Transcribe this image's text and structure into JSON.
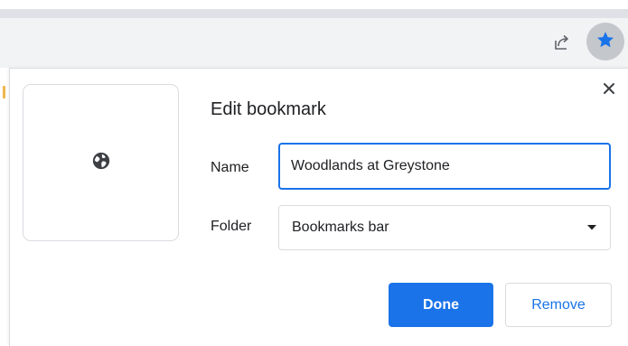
{
  "toolbar": {
    "share_icon": "share-icon",
    "star_icon": "star-filled-icon",
    "star_color": "#1a73e8"
  },
  "dialog": {
    "title": "Edit bookmark",
    "thumbnail_icon": "globe-icon",
    "close_icon": "close-icon",
    "name_label": "Name",
    "name_value": "Woodlands at Greystone",
    "folder_label": "Folder",
    "folder_value": "Bookmarks bar",
    "done_label": "Done",
    "remove_label": "Remove",
    "accent_color": "#1a73e8"
  }
}
